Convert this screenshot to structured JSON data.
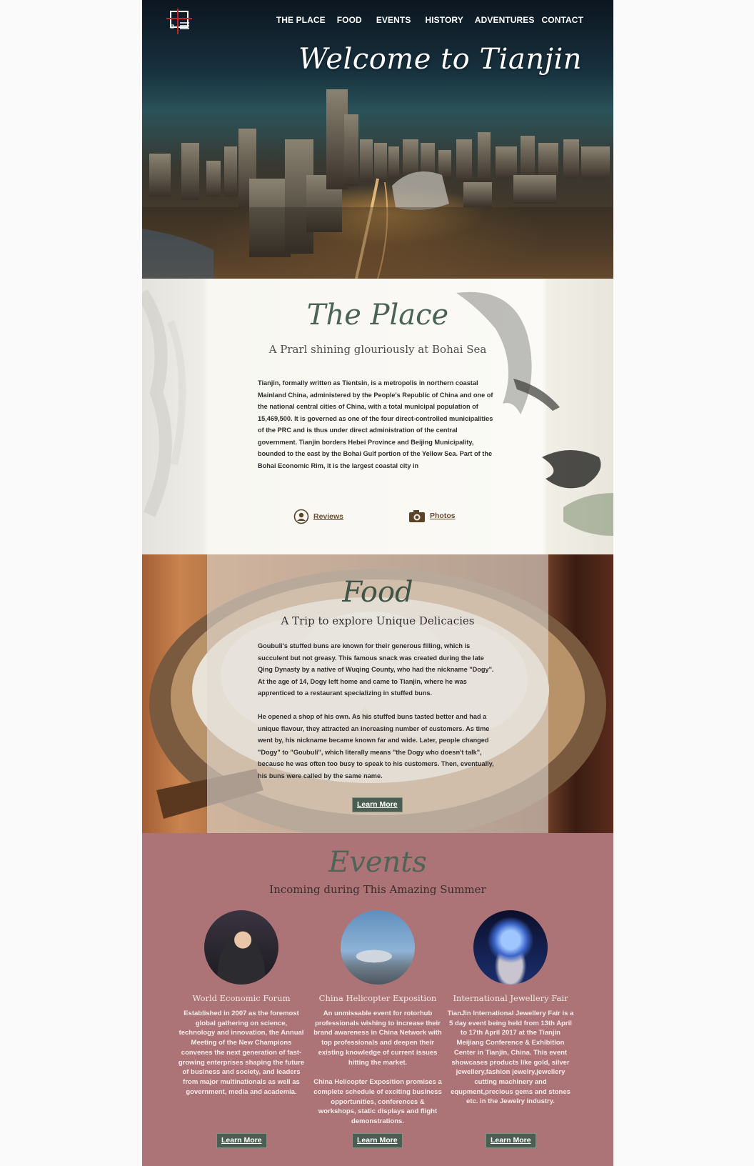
{
  "nav": {
    "items": [
      "THE PLACE",
      "FOOD",
      "EVENTS",
      "HISTORY",
      "ADVENTURES",
      "CONTACT"
    ]
  },
  "hero": {
    "title": "Welcome to Tianjin"
  },
  "place": {
    "title": "The Place",
    "subtitle": "A Prarl shining glouriously at Bohai Sea",
    "body": "Tianjin, formally written as Tientsin, is a metropolis in northern coastal Mainland China, administered by the People's Republic of China and one of the national central cities of China, with a total municipal population of 15,469,500. It is governed as one of the four direct-controlled municipalities of the PRC and is thus under direct administration of the central government. Tianjin borders Hebei Province and Beijing Municipality, bounded to the east by the Bohai Gulf portion of the Yellow Sea. Part of the Bohai Economic Rim, it is the largest coastal city in",
    "links": {
      "reviews": "Reviews",
      "photos": "Photos"
    }
  },
  "food": {
    "title": "Food",
    "subtitle": "A Trip to explore Unique Delicacies",
    "para1": "Goubuli's stuffed buns are known for their generous filling, which is succulent but not greasy. This famous snack was created during the late Qing Dynasty by a native of Wuqing County, who had the nickname \"Dogy\". At the age of 14, Dogy left home and came to Tianjin, where he was apprenticed to a restaurant specializing in stuffed buns.",
    "para2": "He opened a shop of his own. As his stuffed buns tasted better and had a unique flavour, they attracted an increasing number of customers. As time went by, his nickname became known far and wide. Later, people changed \"Dogy\" to \"Goubuli\", which literally means \"the Dogy who doesn't talk\", because he was often too busy to speak to his customers. Then, eventually, his buns were called by the same name.",
    "button": "Learn More"
  },
  "events": {
    "title": "Events",
    "subtitle": "Incoming during This Amazing Summer",
    "cards": [
      {
        "name": "World Economic Forum",
        "desc1": "Established in 2007 as the foremost global gathering on science, technology and innovation, the Annual Meeting of the New Champions convenes the next generation of fast-growing enterprises shaping the future of business and society, and leaders from major multinationals as well as government, media and academia.",
        "desc2": "",
        "button": "Learn More"
      },
      {
        "name": "China Helicopter Exposition",
        "desc1": "An unmissable event for rotorhub professionals wishing to increase their brand awareness in China Network with top professionals and deepen their existing knowledge of current issues hitting the market.",
        "desc2": "China Helicopter Exposition promises a complete schedule of exciting business opportunities, conferences & workshops, static displays and flight demonstrations.",
        "button": "Learn More"
      },
      {
        "name": "International Jewellery Fair",
        "desc1": "TianJin International Jewellery Fair is a 5 day event being held from 13th April to 17th April 2017 at the Tianjin Meijiang Conference & Exhibition Center in Tianjin, China. This event showcases products like gold, silver jewellery,fashion jewelry,jewellery cutting machinery and equpment,precious gems and stones etc. in the Jewelry industry.",
        "desc2": "",
        "button": "Learn More"
      }
    ]
  },
  "colors": {
    "accent_green": "#4a5e51",
    "events_bg": "#ad7477",
    "link_brown": "#6a4f33"
  }
}
